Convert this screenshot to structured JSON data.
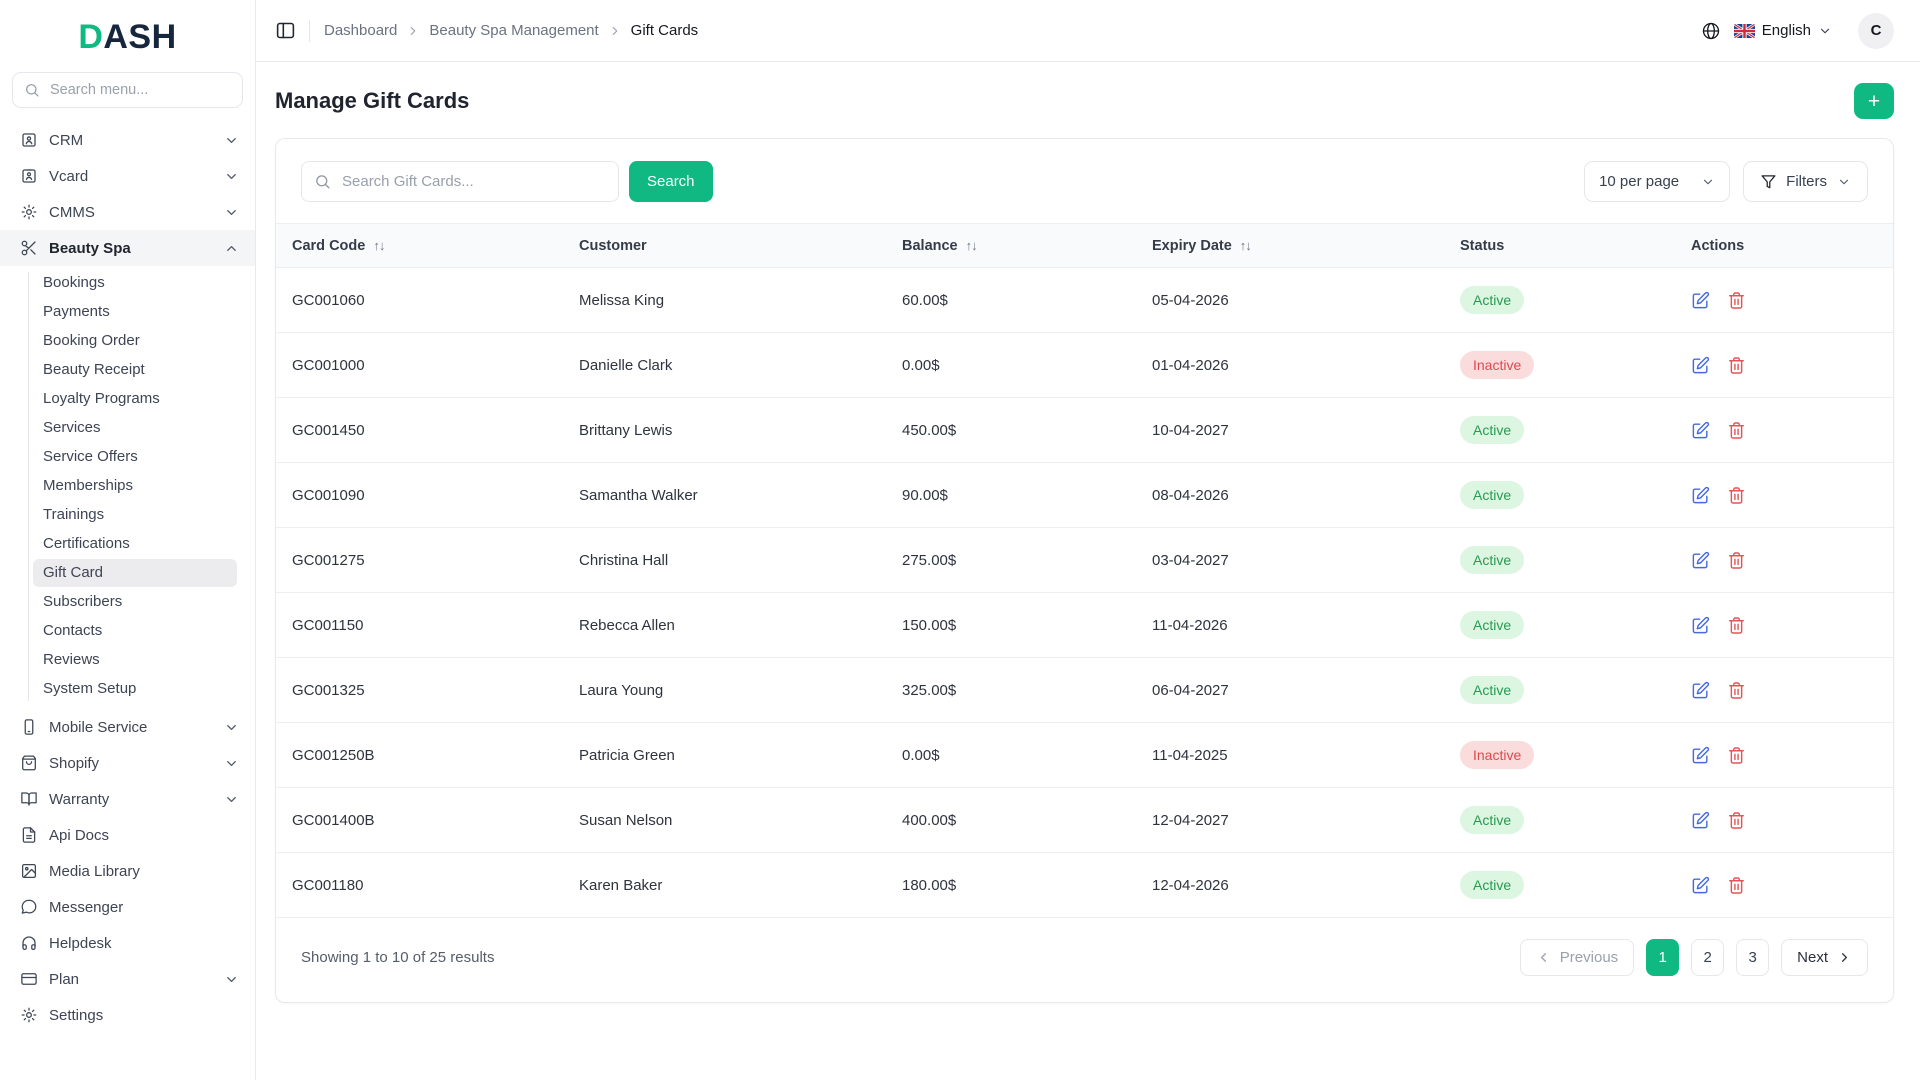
{
  "brand": {
    "accent_letter": "D",
    "rest_letters": "ASH"
  },
  "sidebar": {
    "search_placeholder": "Search menu...",
    "items": [
      {
        "label": "CRM"
      },
      {
        "label": "Vcard"
      },
      {
        "label": "CMMS"
      },
      {
        "label": "Beauty Spa"
      },
      {
        "label": "Mobile Service"
      },
      {
        "label": "Shopify"
      },
      {
        "label": "Warranty"
      },
      {
        "label": "Api Docs"
      },
      {
        "label": "Media Library"
      },
      {
        "label": "Messenger"
      },
      {
        "label": "Helpdesk"
      },
      {
        "label": "Plan"
      },
      {
        "label": "Settings"
      }
    ],
    "beauty_spa_children": [
      {
        "label": "Bookings"
      },
      {
        "label": "Payments"
      },
      {
        "label": "Booking Order"
      },
      {
        "label": "Beauty Receipt"
      },
      {
        "label": "Loyalty Programs"
      },
      {
        "label": "Services"
      },
      {
        "label": "Service Offers"
      },
      {
        "label": "Memberships"
      },
      {
        "label": "Trainings"
      },
      {
        "label": "Certifications"
      },
      {
        "label": "Gift Card",
        "active": true
      },
      {
        "label": "Subscribers"
      },
      {
        "label": "Contacts"
      },
      {
        "label": "Reviews"
      },
      {
        "label": "System Setup"
      }
    ]
  },
  "topbar": {
    "breadcrumbs": [
      "Dashboard",
      "Beauty Spa Management",
      "Gift Cards"
    ],
    "language": "English",
    "avatar_initial": "C"
  },
  "page": {
    "title": "Manage Gift Cards",
    "add_button": "+"
  },
  "toolbar": {
    "search_placeholder": "Search Gift Cards...",
    "search_button": "Search",
    "per_page": "10 per page",
    "filters_label": "Filters"
  },
  "table": {
    "columns": [
      {
        "label": "Card Code"
      },
      {
        "label": "Customer"
      },
      {
        "label": "Balance"
      },
      {
        "label": "Expiry Date"
      },
      {
        "label": "Status"
      },
      {
        "label": "Actions"
      }
    ],
    "rows": [
      {
        "code": "GC001060",
        "customer": "Melissa King",
        "balance": "60.00$",
        "expiry": "05-04-2026",
        "status": "Active"
      },
      {
        "code": "GC001000",
        "customer": "Danielle Clark",
        "balance": "0.00$",
        "expiry": "01-04-2026",
        "status": "Inactive"
      },
      {
        "code": "GC001450",
        "customer": "Brittany Lewis",
        "balance": "450.00$",
        "expiry": "10-04-2027",
        "status": "Active"
      },
      {
        "code": "GC001090",
        "customer": "Samantha Walker",
        "balance": "90.00$",
        "expiry": "08-04-2026",
        "status": "Active"
      },
      {
        "code": "GC001275",
        "customer": "Christina Hall",
        "balance": "275.00$",
        "expiry": "03-04-2027",
        "status": "Active"
      },
      {
        "code": "GC001150",
        "customer": "Rebecca Allen",
        "balance": "150.00$",
        "expiry": "11-04-2026",
        "status": "Active"
      },
      {
        "code": "GC001325",
        "customer": "Laura Young",
        "balance": "325.00$",
        "expiry": "06-04-2027",
        "status": "Active"
      },
      {
        "code": "GC001250B",
        "customer": "Patricia Green",
        "balance": "0.00$",
        "expiry": "11-04-2025",
        "status": "Inactive"
      },
      {
        "code": "GC001400B",
        "customer": "Susan Nelson",
        "balance": "400.00$",
        "expiry": "12-04-2027",
        "status": "Active"
      },
      {
        "code": "GC001180",
        "customer": "Karen Baker",
        "balance": "180.00$",
        "expiry": "12-04-2026",
        "status": "Active"
      }
    ]
  },
  "footer": {
    "summary": "Showing 1 to 10 of 25 results",
    "previous": "Previous",
    "next": "Next",
    "pages": [
      {
        "label": "1",
        "active": true
      },
      {
        "label": "2"
      },
      {
        "label": "3"
      }
    ]
  },
  "colors": {
    "accent_green": "#10b981",
    "active_badge_bg": "#dcf6e2",
    "active_badge_text": "#279b51",
    "inactive_badge_bg": "#fbdcdc",
    "inactive_badge_text": "#dd4950",
    "edit_icon": "#4569e1",
    "delete_icon": "#e25555"
  }
}
